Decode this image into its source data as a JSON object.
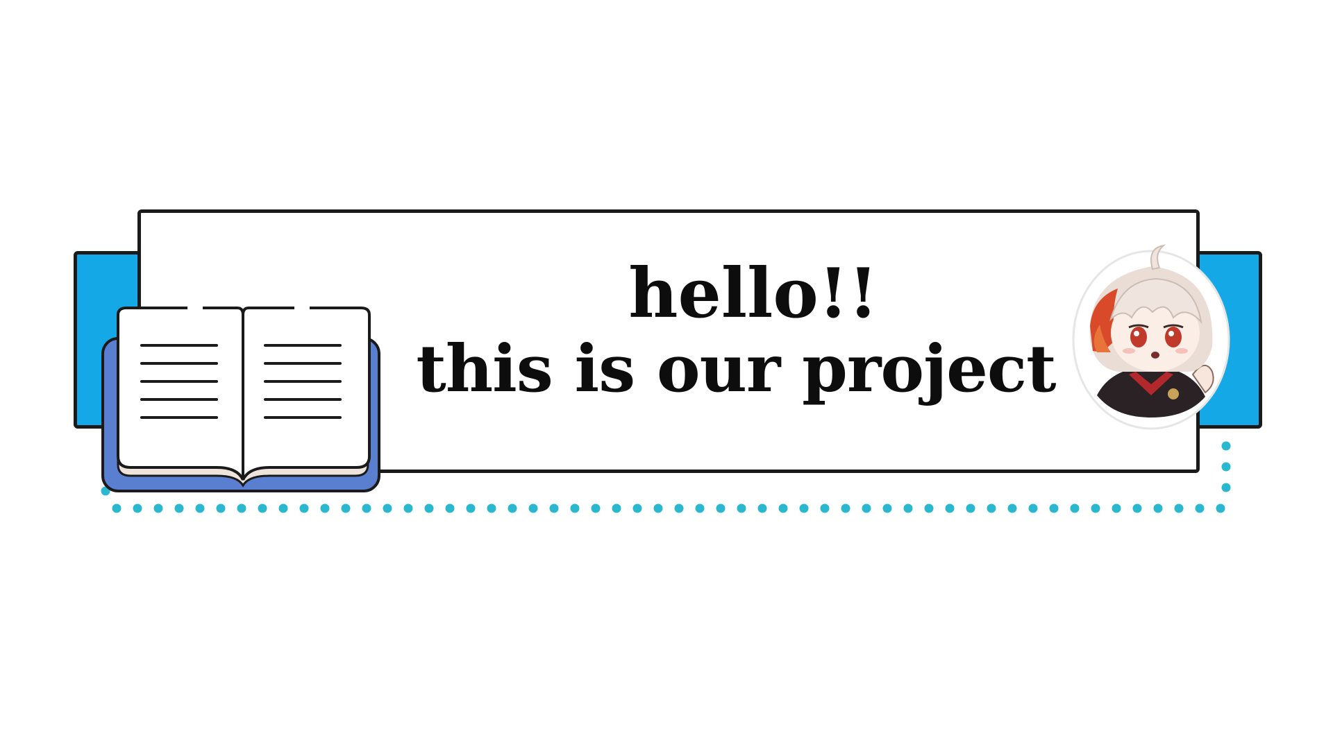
{
  "banner": {
    "line1": "hello!!",
    "line2": "this is our project"
  },
  "colors": {
    "accent_blue": "#14a9e6",
    "book_blue": "#5a7fd0",
    "dot_teal": "#29b8d0",
    "outline": "#1a1a1a"
  },
  "icons": {
    "book": "open-book-icon",
    "sticker": "chibi-character-sticker"
  }
}
